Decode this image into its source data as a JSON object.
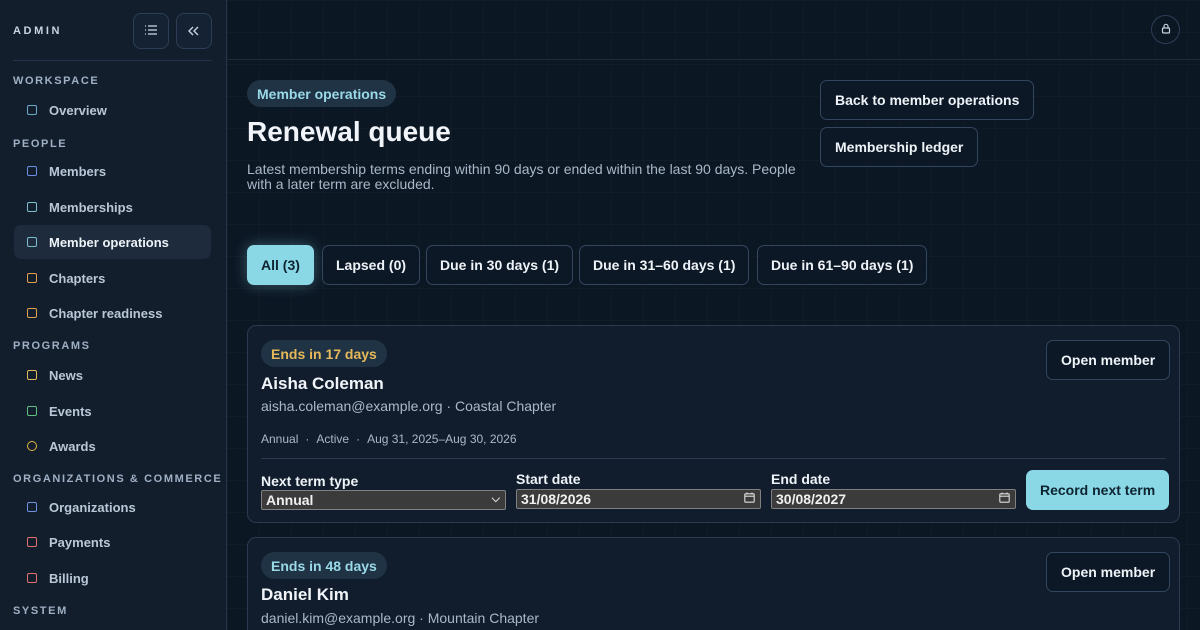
{
  "sidebar": {
    "brand": "ADMIN",
    "sections": {
      "workspace": "WORKSPACE",
      "people": "PEOPLE",
      "programs": "PROGRAMS",
      "orgs": "ORGANIZATIONS & COMMERCE",
      "system": "SYSTEM"
    },
    "items": [
      {
        "label": "Overview",
        "icon": "grid-icon",
        "color": "#6aa9c8"
      },
      {
        "label": "Members",
        "icon": "users-icon",
        "color": "#6a8fe0"
      },
      {
        "label": "Memberships",
        "icon": "card-icon",
        "color": "#7cc0d0"
      },
      {
        "label": "Member operations",
        "icon": "card-icon",
        "color": "#7cc0d0"
      },
      {
        "label": "Chapters",
        "icon": "home-icon",
        "color": "#e0a050"
      },
      {
        "label": "Chapter readiness",
        "icon": "home-icon",
        "color": "#e0a050"
      },
      {
        "label": "News",
        "icon": "newspaper-icon",
        "color": "#e0b860"
      },
      {
        "label": "Events",
        "icon": "calendar-icon",
        "color": "#60c080"
      },
      {
        "label": "Awards",
        "icon": "award-icon",
        "color": "#e0b840"
      },
      {
        "label": "Organizations",
        "icon": "building-icon",
        "color": "#7090e0"
      },
      {
        "label": "Payments",
        "icon": "credit-card-icon",
        "color": "#e07070"
      },
      {
        "label": "Billing",
        "icon": "credit-card-icon",
        "color": "#e07070"
      }
    ]
  },
  "header": {
    "section_pill": "Member operations",
    "title": "Renewal queue",
    "description": "Latest membership terms ending within 90 days or ended within the last 90 days. People with a later term are excluded.",
    "back_button": "Back to member operations",
    "ledger_button": "Membership ledger"
  },
  "filters": [
    {
      "label": "All (3)",
      "active": true
    },
    {
      "label": "Lapsed (0)",
      "active": false
    },
    {
      "label": "Due in 30 days (1)",
      "active": false
    },
    {
      "label": "Due in 31–60 days (1)",
      "active": false
    },
    {
      "label": "Due in 61–90 days (1)",
      "active": false
    }
  ],
  "renewals": [
    {
      "badge": "Ends in 17 days",
      "name": "Aisha Coleman",
      "email": "aisha.coleman@example.org",
      "chapter": "Coastal Chapter",
      "term": "Annual",
      "status": "Active",
      "range": "Aug 31, 2025–Aug 30, 2026",
      "open_label": "Open member",
      "next_term_label": "Next term type",
      "next_term_value": "Annual",
      "start_label": "Start date",
      "start_value": "31/08/2026",
      "end_label": "End date",
      "end_value": "30/08/2027",
      "record_label": "Record next term"
    },
    {
      "badge": "Ends in 48 days",
      "name": "Daniel Kim",
      "email": "daniel.kim@example.org",
      "chapter": "Mountain Chapter",
      "open_label": "Open member"
    }
  ],
  "colors": {
    "accent": "#8ad7e6",
    "warning": "#e6b85a",
    "background": "#0c1724"
  }
}
